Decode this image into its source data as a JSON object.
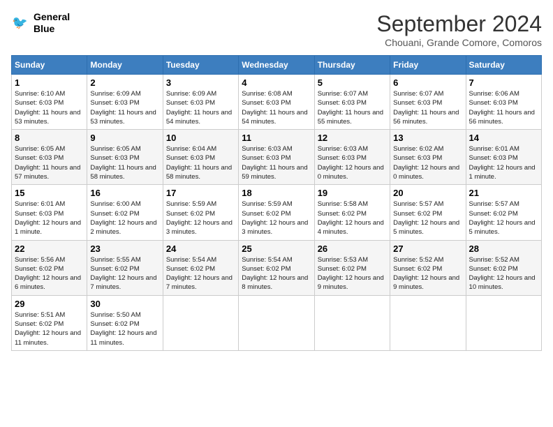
{
  "header": {
    "logo_line1": "General",
    "logo_line2": "Blue",
    "month": "September 2024",
    "location": "Chouani, Grande Comore, Comoros"
  },
  "days_of_week": [
    "Sunday",
    "Monday",
    "Tuesday",
    "Wednesday",
    "Thursday",
    "Friday",
    "Saturday"
  ],
  "weeks": [
    [
      {
        "day": "1",
        "sunrise": "Sunrise: 6:10 AM",
        "sunset": "Sunset: 6:03 PM",
        "daylight": "Daylight: 11 hours and 53 minutes."
      },
      {
        "day": "2",
        "sunrise": "Sunrise: 6:09 AM",
        "sunset": "Sunset: 6:03 PM",
        "daylight": "Daylight: 11 hours and 53 minutes."
      },
      {
        "day": "3",
        "sunrise": "Sunrise: 6:09 AM",
        "sunset": "Sunset: 6:03 PM",
        "daylight": "Daylight: 11 hours and 54 minutes."
      },
      {
        "day": "4",
        "sunrise": "Sunrise: 6:08 AM",
        "sunset": "Sunset: 6:03 PM",
        "daylight": "Daylight: 11 hours and 54 minutes."
      },
      {
        "day": "5",
        "sunrise": "Sunrise: 6:07 AM",
        "sunset": "Sunset: 6:03 PM",
        "daylight": "Daylight: 11 hours and 55 minutes."
      },
      {
        "day": "6",
        "sunrise": "Sunrise: 6:07 AM",
        "sunset": "Sunset: 6:03 PM",
        "daylight": "Daylight: 11 hours and 56 minutes."
      },
      {
        "day": "7",
        "sunrise": "Sunrise: 6:06 AM",
        "sunset": "Sunset: 6:03 PM",
        "daylight": "Daylight: 11 hours and 56 minutes."
      }
    ],
    [
      {
        "day": "8",
        "sunrise": "Sunrise: 6:05 AM",
        "sunset": "Sunset: 6:03 PM",
        "daylight": "Daylight: 11 hours and 57 minutes."
      },
      {
        "day": "9",
        "sunrise": "Sunrise: 6:05 AM",
        "sunset": "Sunset: 6:03 PM",
        "daylight": "Daylight: 11 hours and 58 minutes."
      },
      {
        "day": "10",
        "sunrise": "Sunrise: 6:04 AM",
        "sunset": "Sunset: 6:03 PM",
        "daylight": "Daylight: 11 hours and 58 minutes."
      },
      {
        "day": "11",
        "sunrise": "Sunrise: 6:03 AM",
        "sunset": "Sunset: 6:03 PM",
        "daylight": "Daylight: 11 hours and 59 minutes."
      },
      {
        "day": "12",
        "sunrise": "Sunrise: 6:03 AM",
        "sunset": "Sunset: 6:03 PM",
        "daylight": "Daylight: 12 hours and 0 minutes."
      },
      {
        "day": "13",
        "sunrise": "Sunrise: 6:02 AM",
        "sunset": "Sunset: 6:03 PM",
        "daylight": "Daylight: 12 hours and 0 minutes."
      },
      {
        "day": "14",
        "sunrise": "Sunrise: 6:01 AM",
        "sunset": "Sunset: 6:03 PM",
        "daylight": "Daylight: 12 hours and 1 minute."
      }
    ],
    [
      {
        "day": "15",
        "sunrise": "Sunrise: 6:01 AM",
        "sunset": "Sunset: 6:03 PM",
        "daylight": "Daylight: 12 hours and 1 minute."
      },
      {
        "day": "16",
        "sunrise": "Sunrise: 6:00 AM",
        "sunset": "Sunset: 6:02 PM",
        "daylight": "Daylight: 12 hours and 2 minutes."
      },
      {
        "day": "17",
        "sunrise": "Sunrise: 5:59 AM",
        "sunset": "Sunset: 6:02 PM",
        "daylight": "Daylight: 12 hours and 3 minutes."
      },
      {
        "day": "18",
        "sunrise": "Sunrise: 5:59 AM",
        "sunset": "Sunset: 6:02 PM",
        "daylight": "Daylight: 12 hours and 3 minutes."
      },
      {
        "day": "19",
        "sunrise": "Sunrise: 5:58 AM",
        "sunset": "Sunset: 6:02 PM",
        "daylight": "Daylight: 12 hours and 4 minutes."
      },
      {
        "day": "20",
        "sunrise": "Sunrise: 5:57 AM",
        "sunset": "Sunset: 6:02 PM",
        "daylight": "Daylight: 12 hours and 5 minutes."
      },
      {
        "day": "21",
        "sunrise": "Sunrise: 5:57 AM",
        "sunset": "Sunset: 6:02 PM",
        "daylight": "Daylight: 12 hours and 5 minutes."
      }
    ],
    [
      {
        "day": "22",
        "sunrise": "Sunrise: 5:56 AM",
        "sunset": "Sunset: 6:02 PM",
        "daylight": "Daylight: 12 hours and 6 minutes."
      },
      {
        "day": "23",
        "sunrise": "Sunrise: 5:55 AM",
        "sunset": "Sunset: 6:02 PM",
        "daylight": "Daylight: 12 hours and 7 minutes."
      },
      {
        "day": "24",
        "sunrise": "Sunrise: 5:54 AM",
        "sunset": "Sunset: 6:02 PM",
        "daylight": "Daylight: 12 hours and 7 minutes."
      },
      {
        "day": "25",
        "sunrise": "Sunrise: 5:54 AM",
        "sunset": "Sunset: 6:02 PM",
        "daylight": "Daylight: 12 hours and 8 minutes."
      },
      {
        "day": "26",
        "sunrise": "Sunrise: 5:53 AM",
        "sunset": "Sunset: 6:02 PM",
        "daylight": "Daylight: 12 hours and 9 minutes."
      },
      {
        "day": "27",
        "sunrise": "Sunrise: 5:52 AM",
        "sunset": "Sunset: 6:02 PM",
        "daylight": "Daylight: 12 hours and 9 minutes."
      },
      {
        "day": "28",
        "sunrise": "Sunrise: 5:52 AM",
        "sunset": "Sunset: 6:02 PM",
        "daylight": "Daylight: 12 hours and 10 minutes."
      }
    ],
    [
      {
        "day": "29",
        "sunrise": "Sunrise: 5:51 AM",
        "sunset": "Sunset: 6:02 PM",
        "daylight": "Daylight: 12 hours and 11 minutes."
      },
      {
        "day": "30",
        "sunrise": "Sunrise: 5:50 AM",
        "sunset": "Sunset: 6:02 PM",
        "daylight": "Daylight: 12 hours and 11 minutes."
      },
      null,
      null,
      null,
      null,
      null
    ]
  ]
}
